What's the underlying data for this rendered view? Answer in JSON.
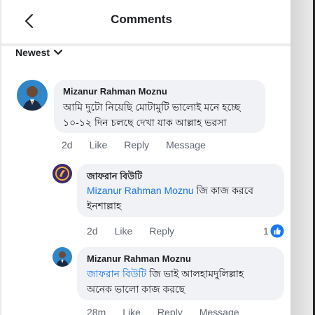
{
  "header": {
    "title": "Comments"
  },
  "sort": {
    "label": "Newest"
  },
  "comments": [
    {
      "author": "Mizanur Rahman Moznu",
      "line1": "আমি দুটো নিয়েছি মোটামুটি ভালোই মনে হচ্ছে",
      "line2": "১০-১২ দিন চলছে দেখা যাক আল্লাহ ভরসা",
      "time": "2d",
      "like": "Like",
      "reply": "Reply",
      "message": "Message"
    },
    {
      "author": "জাফরান বিউটি",
      "mention": "Mizanur Rahman Moznu",
      "after": " জি কাজ করবে",
      "line2": "ইনশাল্লাহ",
      "time": "2d",
      "like": "Like",
      "reply": "Reply",
      "reaction_count": "1"
    },
    {
      "author": "Mizanur Rahman Moznu",
      "mention": "জাফরান বিউটি",
      "after": "  জি ভাই আলহামদুলিল্লাহ",
      "line2": "অনেক ভালো কাজ করছে",
      "time": "28m",
      "like": "Like",
      "reply": "Reply",
      "message": "Message"
    }
  ]
}
